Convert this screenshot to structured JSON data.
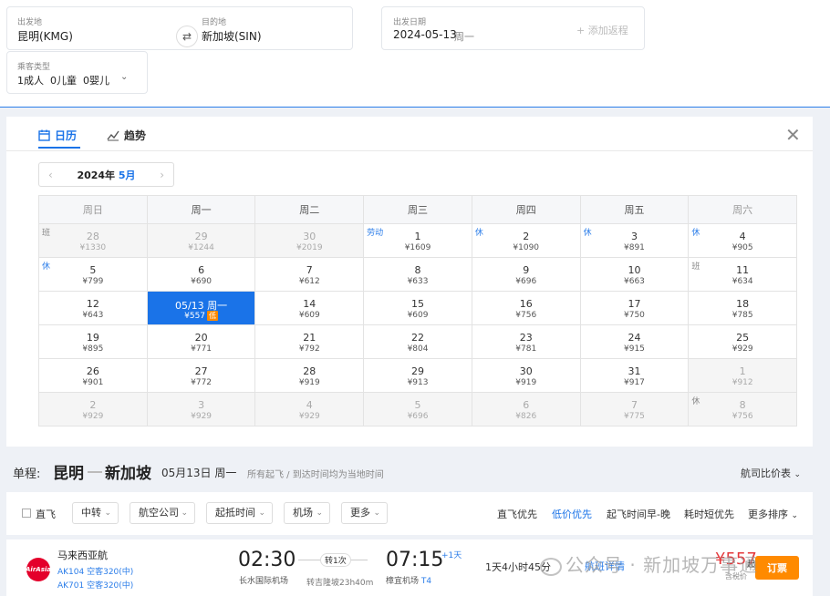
{
  "search": {
    "from_label": "出发地",
    "from_value": "昆明(KMG)",
    "to_label": "目的地",
    "to_value": "新加坡(SIN)",
    "date_label": "出发日期",
    "date_value": "2024-05-13",
    "date_weekday": "周一",
    "add_trip": "+ 添加返程",
    "pax_label": "乘客类型",
    "pax_value": "1成人  0儿童  0婴儿"
  },
  "calendar": {
    "tabs": [
      {
        "label": "日历"
      },
      {
        "label": "趋势"
      }
    ],
    "year": "2024年",
    "month": "5月",
    "weekdays": [
      "周日",
      "周一",
      "周二",
      "周三",
      "周四",
      "周五",
      "周六"
    ],
    "weeks": [
      [
        {
          "day": "28",
          "price": "¥1330",
          "out": true,
          "tag": "班"
        },
        {
          "day": "29",
          "price": "¥1244",
          "out": true
        },
        {
          "day": "30",
          "price": "¥2019",
          "out": true
        },
        {
          "day": "1",
          "price": "¥1609",
          "tag": "劳动"
        },
        {
          "day": "2",
          "price": "¥1090",
          "tag": "休"
        },
        {
          "day": "3",
          "price": "¥891",
          "tag": "休"
        },
        {
          "day": "4",
          "price": "¥905",
          "tag": "休"
        }
      ],
      [
        {
          "day": "5",
          "price": "¥799",
          "tag": "休"
        },
        {
          "day": "6",
          "price": "¥690"
        },
        {
          "day": "7",
          "price": "¥612"
        },
        {
          "day": "8",
          "price": "¥633"
        },
        {
          "day": "9",
          "price": "¥696"
        },
        {
          "day": "10",
          "price": "¥663"
        },
        {
          "day": "11",
          "price": "¥634",
          "tag": "班"
        }
      ],
      [
        {
          "day": "12",
          "price": "¥643"
        },
        {
          "day": "05/13 周一",
          "price": "¥557",
          "selected": true,
          "low": "低"
        },
        {
          "day": "14",
          "price": "¥609"
        },
        {
          "day": "15",
          "price": "¥609"
        },
        {
          "day": "16",
          "price": "¥756"
        },
        {
          "day": "17",
          "price": "¥750"
        },
        {
          "day": "18",
          "price": "¥785"
        }
      ],
      [
        {
          "day": "19",
          "price": "¥895"
        },
        {
          "day": "20",
          "price": "¥771"
        },
        {
          "day": "21",
          "price": "¥792"
        },
        {
          "day": "22",
          "price": "¥804"
        },
        {
          "day": "23",
          "price": "¥781"
        },
        {
          "day": "24",
          "price": "¥915"
        },
        {
          "day": "25",
          "price": "¥929"
        }
      ],
      [
        {
          "day": "26",
          "price": "¥901"
        },
        {
          "day": "27",
          "price": "¥772"
        },
        {
          "day": "28",
          "price": "¥919"
        },
        {
          "day": "29",
          "price": "¥913"
        },
        {
          "day": "30",
          "price": "¥919"
        },
        {
          "day": "31",
          "price": "¥917"
        },
        {
          "day": "1",
          "price": "¥912",
          "out": true
        }
      ],
      [
        {
          "day": "2",
          "price": "¥929",
          "out": true
        },
        {
          "day": "3",
          "price": "¥929",
          "out": true
        },
        {
          "day": "4",
          "price": "¥929",
          "out": true
        },
        {
          "day": "5",
          "price": "¥696",
          "out": true
        },
        {
          "day": "6",
          "price": "¥826",
          "out": true
        },
        {
          "day": "7",
          "price": "¥775",
          "out": true
        },
        {
          "day": "8",
          "price": "¥756",
          "out": true,
          "tag": "休"
        }
      ]
    ]
  },
  "results": {
    "trip_type": "单程:",
    "from_city": "昆明",
    "to_city": "新加坡",
    "date": "05月13日 周一",
    "note": "所有起飞 / 到达时间均为当地时间",
    "compare": "航司比价表"
  },
  "filters": {
    "direct": "直飞",
    "dropdowns": [
      "中转",
      "航空公司",
      "起抵时间",
      "机场",
      "更多"
    ],
    "sorts": [
      "直飞优先",
      "低价优先",
      "起飞时间早-晚",
      "耗时短优先",
      "更多排序"
    ],
    "active_sort_index": 1
  },
  "flight": {
    "logo_text": "AirAsia",
    "airline": "马来西亚航",
    "leg1": "AK104 空客320(中)",
    "leg2": "AK701 空客320(中)",
    "dep_time": "02:30",
    "dep_airport": "长水国际机场",
    "transfer": "转1次",
    "stopover": "转吉隆坡23h40m",
    "arr_time": "07:15",
    "arr_airport": "樟宜机场",
    "arr_terminal": "T4",
    "plus_day": "+1天",
    "duration": "1天4小时45分",
    "detail": "航班详情",
    "price": "¥557",
    "price_suffix": "起",
    "tax": "含税价",
    "book": "订票"
  },
  "watermark": "公众号 · 新加坡万事通"
}
